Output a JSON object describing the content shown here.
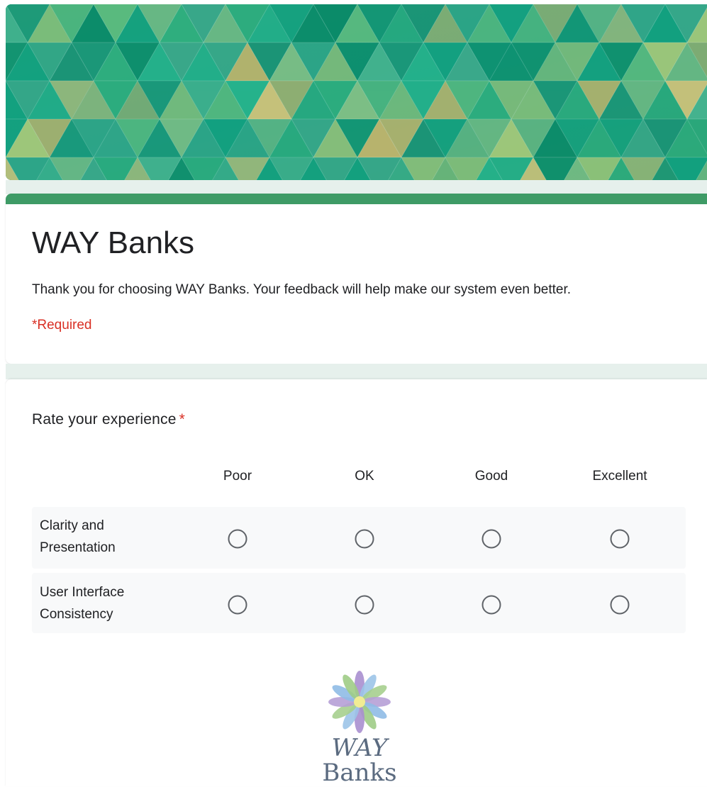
{
  "form": {
    "title": "WAY Banks",
    "description": "Thank you for choosing WAY Banks. Your feedback will help make our system even better.",
    "required_note": "*Required"
  },
  "question": {
    "title": "Rate your experience",
    "required_marker": "*",
    "columns": [
      "Poor",
      "OK",
      "Good",
      "Excellent"
    ],
    "rows": [
      {
        "label": "Clarity and Presentation",
        "selected": null
      },
      {
        "label": "User Interface Consistency",
        "selected": null
      }
    ]
  },
  "logo": {
    "word1": "WAY",
    "word2": "Banks"
  },
  "colors": {
    "accent": "#3e9b66",
    "required": "#d93025",
    "banner": "#1fa17a"
  }
}
